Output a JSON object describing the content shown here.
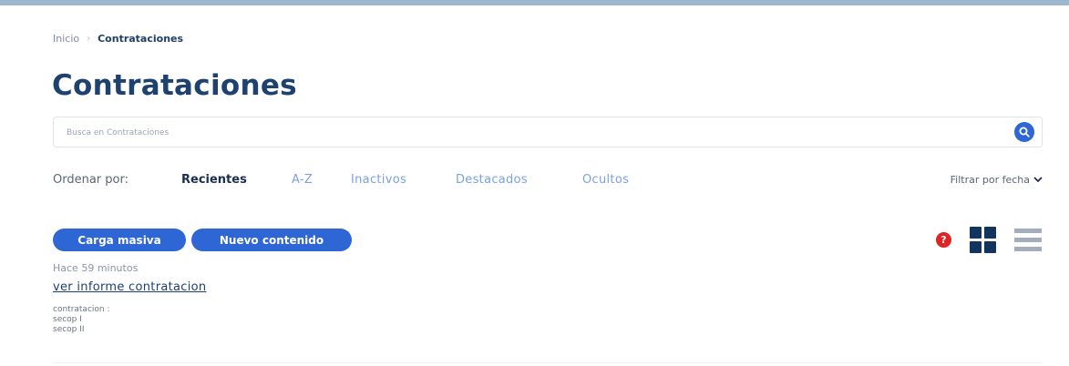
{
  "breadcrumb": {
    "home": "Inicio",
    "separator": "›",
    "current": "Contrataciones"
  },
  "page_title": "Contrataciones",
  "search": {
    "placeholder": "Busca en Contrataciones",
    "value": "",
    "icon": "search-icon"
  },
  "sort": {
    "label": "Ordenar por:",
    "options": [
      "Recientes",
      "A-Z",
      "Inactivos",
      "Destacados",
      "Ocultos"
    ],
    "selected": "Recientes"
  },
  "filter_date": {
    "label": "Filtrar por fecha",
    "icon": "chevron-down-icon"
  },
  "actions": {
    "bulk_upload": "Carga masiva",
    "new_content": "Nuevo contenido"
  },
  "help": {
    "label": "?",
    "icon": "help-icon"
  },
  "view_modes": [
    "grid-view-icon",
    "list-view-icon"
  ],
  "items": [
    {
      "time": "Hace 59 minutos",
      "title": "ver informe contratacion",
      "meta_label": "contratacion :",
      "tags": [
        "secop I",
        "secop II"
      ]
    }
  ],
  "colors": {
    "brand": "#1e4270",
    "accent": "#2f66d6",
    "link_inactive": "#7ba0e6",
    "danger": "#e02424",
    "dark": "#12355f"
  }
}
